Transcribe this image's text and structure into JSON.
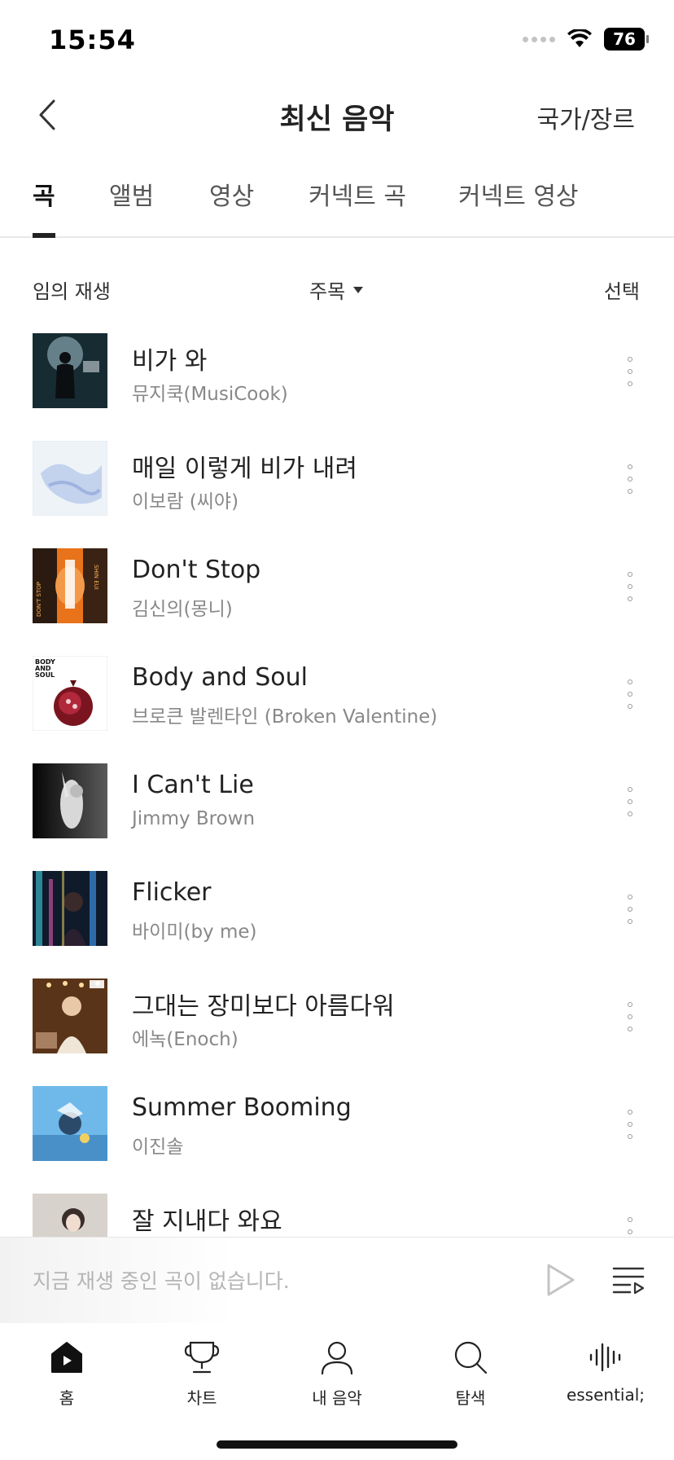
{
  "status_bar": {
    "time": "15:54",
    "battery": "76"
  },
  "header": {
    "title": "최신 음악",
    "action": "국가/장르"
  },
  "tabs": [
    {
      "label": "곡",
      "active": true
    },
    {
      "label": "앨범",
      "active": false
    },
    {
      "label": "영상",
      "active": false
    },
    {
      "label": "커넥트 곡",
      "active": false
    },
    {
      "label": "커넥트 영상",
      "active": false
    }
  ],
  "toolbar": {
    "shuffle_label": "임의 재생",
    "sort_label": "주목",
    "select_label": "선택"
  },
  "songs": [
    {
      "title": "비가 와",
      "artist": "뮤지쿡(MusiCook)",
      "cover": "dark-silhouette"
    },
    {
      "title": "매일 이렇게 비가 내려",
      "artist": "이보람 (씨야)",
      "cover": "pale-blue-watercolor"
    },
    {
      "title": "Don't Stop",
      "artist": "김신의(몽니)",
      "cover": "orange-portrait"
    },
    {
      "title": "Body and Soul",
      "artist": "브로큰 발렌타인 (Broken Valentine)",
      "cover": "pomegranate"
    },
    {
      "title": "I Can't Lie",
      "artist": "Jimmy Brown",
      "cover": "bw-figure"
    },
    {
      "title": "Flicker",
      "artist": "바이미(by me)",
      "cover": "neon-city"
    },
    {
      "title": "그대는 장미보다 아름다워",
      "artist": "에녹(Enoch)",
      "cover": "warm-stage"
    },
    {
      "title": "Summer Booming",
      "artist": "이진솔",
      "cover": "sky-blue"
    },
    {
      "title": "잘 지내다 와요",
      "artist": "",
      "cover": "soft-portrait"
    }
  ],
  "cover_art_labels": {
    "dont_stop": {
      "vertical_left": "DON'T STOP",
      "vertical_right": "SHIN EUI"
    },
    "body_and_soul": [
      "BODY",
      "AND",
      "SOUL"
    ]
  },
  "mini_player": {
    "empty_text": "지금 재생 중인 곡이 없습니다."
  },
  "bottom_nav": [
    {
      "label": "홈",
      "icon": "home-icon",
      "active": true
    },
    {
      "label": "차트",
      "icon": "trophy-icon",
      "active": false
    },
    {
      "label": "내 음악",
      "icon": "person-icon",
      "active": false
    },
    {
      "label": "탐색",
      "icon": "search-icon",
      "active": false
    },
    {
      "label": "essential;",
      "icon": "waveform-icon",
      "active": false
    }
  ]
}
